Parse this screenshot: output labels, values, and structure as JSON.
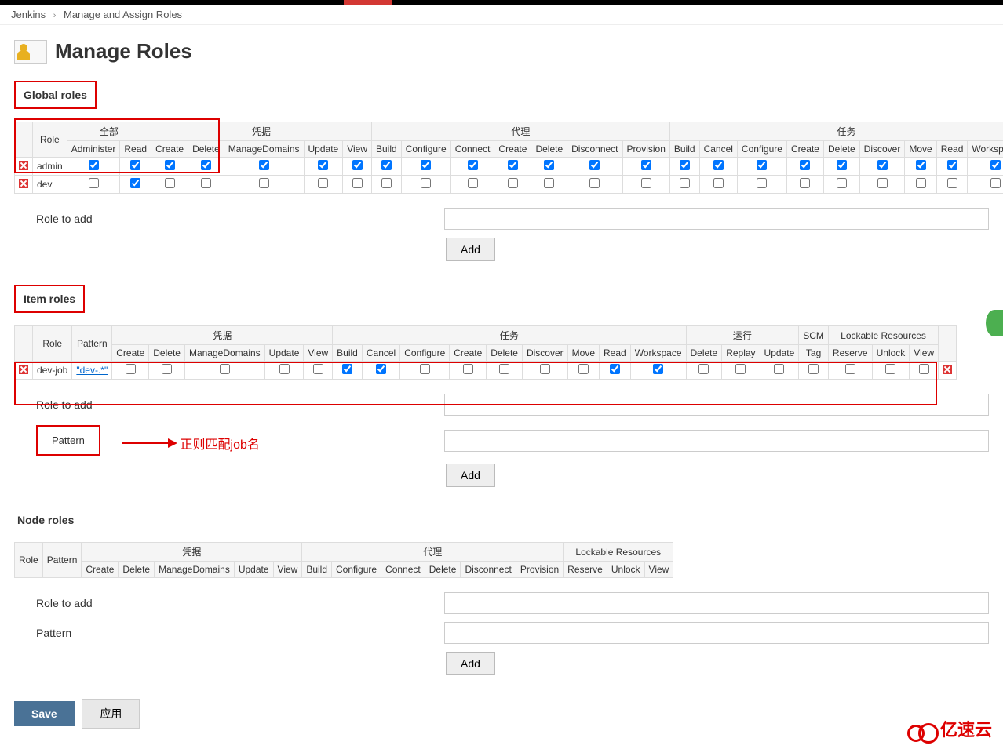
{
  "breadcrumb": {
    "root": "Jenkins",
    "sep": "›",
    "page": "Manage and Assign Roles"
  },
  "title": "Manage Roles",
  "global": {
    "section": "Global roles",
    "roleHeader": "Role",
    "groups": {
      "all": "全部",
      "cred": "凭据",
      "agent": "代理",
      "job": "任务"
    },
    "cols": {
      "administer": "Administer",
      "read": "Read",
      "cCreate": "Create",
      "cDelete": "Delete",
      "cManage": "ManageDomains",
      "cUpdate": "Update",
      "cView": "View",
      "aBuild": "Build",
      "aConfigure": "Configure",
      "aConnect": "Connect",
      "aCreate": "Create",
      "aDelete": "Delete",
      "aDisconnect": "Disconnect",
      "aProvision": "Provision",
      "jBuild": "Build",
      "jCancel": "Cancel",
      "jConfigure": "Configure",
      "jCreate": "Create",
      "jDelete": "Delete",
      "jDiscover": "Discover",
      "jMove": "Move",
      "jRead": "Read",
      "jWorkspace": "Workspace"
    },
    "rows": {
      "admin": "admin",
      "dev": "dev"
    },
    "addLabel": "Role to add",
    "addBtn": "Add"
  },
  "item": {
    "section": "Item roles",
    "roleHeader": "Role",
    "patternHeader": "Pattern",
    "groups": {
      "cred": "凭据",
      "job": "任务",
      "run": "运行",
      "scm": "SCM",
      "lock": "Lockable Resources"
    },
    "cols": {
      "cCreate": "Create",
      "cDelete": "Delete",
      "cManage": "ManageDomains",
      "cUpdate": "Update",
      "cView": "View",
      "jBuild": "Build",
      "jCancel": "Cancel",
      "jConfigure": "Configure",
      "jCreate": "Create",
      "jDelete": "Delete",
      "jDiscover": "Discover",
      "jMove": "Move",
      "jRead": "Read",
      "jWorkspace": "Workspace",
      "rDelete": "Delete",
      "rReplay": "Replay",
      "rUpdate": "Update",
      "sTag": "Tag",
      "lReserve": "Reserve",
      "lUnlock": "Unlock",
      "lView": "View"
    },
    "row": {
      "name": "dev-job",
      "pattern": "\"dev-.*\""
    },
    "addLabel": "Role to add",
    "patternLabel": "Pattern",
    "addBtn": "Add",
    "annotation": "正则匹配job名"
  },
  "node": {
    "section": "Node roles",
    "roleHeader": "Role",
    "patternHeader": "Pattern",
    "groups": {
      "cred": "凭据",
      "agent": "代理",
      "lock": "Lockable Resources"
    },
    "cols": {
      "cCreate": "Create",
      "cDelete": "Delete",
      "cManage": "ManageDomains",
      "cUpdate": "Update",
      "cView": "View",
      "aBuild": "Build",
      "aConfigure": "Configure",
      "aConnect": "Connect",
      "aDelete": "Delete",
      "aDisconnect": "Disconnect",
      "aProvision": "Provision",
      "lReserve": "Reserve",
      "lUnlock": "Unlock",
      "lView": "View"
    },
    "addLabel": "Role to add",
    "patternLabel": "Pattern",
    "addBtn": "Add"
  },
  "save": {
    "save": "Save",
    "apply": "应用"
  },
  "watermark": "亿速云"
}
